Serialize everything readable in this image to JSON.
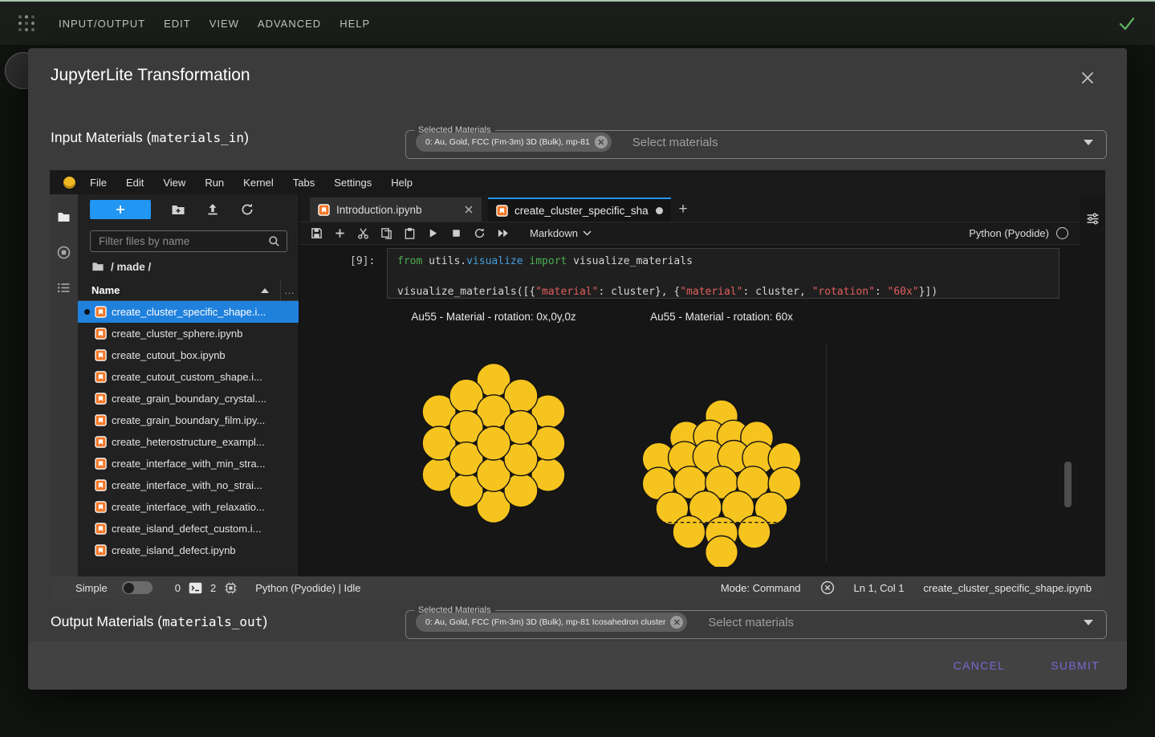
{
  "app_bar": {
    "menus": [
      "INPUT/OUTPUT",
      "EDIT",
      "VIEW",
      "ADVANCED",
      "HELP"
    ]
  },
  "dialog": {
    "title": "JupyterLite Transformation",
    "input_section": {
      "label_prefix": "Input Materials (",
      "label_code": "materials_in",
      "label_suffix": ")",
      "fieldset_label": "Selected Materials",
      "chip": "0: Au, Gold, FCC (Fm-3m) 3D (Bulk), mp-81",
      "placeholder": "Select materials"
    },
    "output_section": {
      "label_prefix": "Output Materials (",
      "label_code": "materials_out",
      "label_suffix": ")",
      "fieldset_label": "Selected Materials",
      "chip": "0: Au, Gold, FCC (Fm-3m) 3D (Bulk), mp-81 Icosahedron cluster",
      "placeholder": "Select materials"
    },
    "cancel_label": "CANCEL",
    "submit_label": "SUBMIT"
  },
  "jupyter": {
    "menus": [
      "File",
      "Edit",
      "View",
      "Run",
      "Kernel",
      "Tabs",
      "Settings",
      "Help"
    ],
    "filebrowser": {
      "filter_placeholder": "Filter files by name",
      "breadcrumb": "/ made /",
      "column_header": "Name",
      "files": [
        {
          "name": "create_cluster_specific_shape.i...",
          "selected": true
        },
        {
          "name": "create_cluster_sphere.ipynb",
          "selected": false
        },
        {
          "name": "create_cutout_box.ipynb",
          "selected": false
        },
        {
          "name": "create_cutout_custom_shape.i...",
          "selected": false
        },
        {
          "name": "create_grain_boundary_crystal....",
          "selected": false
        },
        {
          "name": "create_grain_boundary_film.ipy...",
          "selected": false
        },
        {
          "name": "create_heterostructure_exampl...",
          "selected": false
        },
        {
          "name": "create_interface_with_min_stra...",
          "selected": false
        },
        {
          "name": "create_interface_with_no_strai...",
          "selected": false
        },
        {
          "name": "create_interface_with_relaxatio...",
          "selected": false
        },
        {
          "name": "create_island_defect_custom.i...",
          "selected": false
        },
        {
          "name": "create_island_defect.ipynb",
          "selected": false
        }
      ]
    },
    "tabs": {
      "tab1": "Introduction.ipynb",
      "tab2": "create_cluster_specific_sha"
    },
    "toolbar": {
      "cell_type": "Markdown",
      "kernel": "Python (Pyodide)"
    },
    "cell": {
      "prompt": "[9]:",
      "lines": [
        [
          {
            "t": "from ",
            "c": "kw"
          },
          {
            "t": "utils.",
            "c": "pl"
          },
          {
            "t": "visualize",
            "c": "prop"
          },
          {
            "t": " ",
            "c": "pl"
          },
          {
            "t": "import",
            "c": "kw"
          },
          {
            "t": " visualize_materials",
            "c": "pl"
          }
        ],
        [],
        [
          {
            "t": "visualize_materials([{",
            "c": "pl"
          },
          {
            "t": "\"material\"",
            "c": "str"
          },
          {
            "t": ": cluster}, {",
            "c": "pl"
          },
          {
            "t": "\"material\"",
            "c": "str"
          },
          {
            "t": ": cluster, ",
            "c": "pl"
          },
          {
            "t": "\"rotation\"",
            "c": "str"
          },
          {
            "t": ": ",
            "c": "pl"
          },
          {
            "t": "\"60x\"",
            "c": "str"
          },
          {
            "t": "}])",
            "c": "pl"
          }
        ]
      ]
    },
    "outputs": [
      {
        "title": "Au55 - Material - rotation: 0x,0y,0z"
      },
      {
        "title": "Au55 - Material - rotation: 60x"
      }
    ],
    "atom_color": "#f6c41f",
    "statusbar": {
      "simple_label": "Simple",
      "terminal_count": "0",
      "kernel_count": "2",
      "kernel_status": "Python (Pyodide) | Idle",
      "mode": "Mode: Command",
      "cursor": "Ln 1, Col 1",
      "filename": "create_cluster_specific_shape.ipynb"
    }
  },
  "colors": {
    "accent_blue": "#2196f3",
    "purple": "#7668d2",
    "gold": "#f6c41f",
    "notebook_orange": "#f37726",
    "check_green": "#5fbf63"
  }
}
